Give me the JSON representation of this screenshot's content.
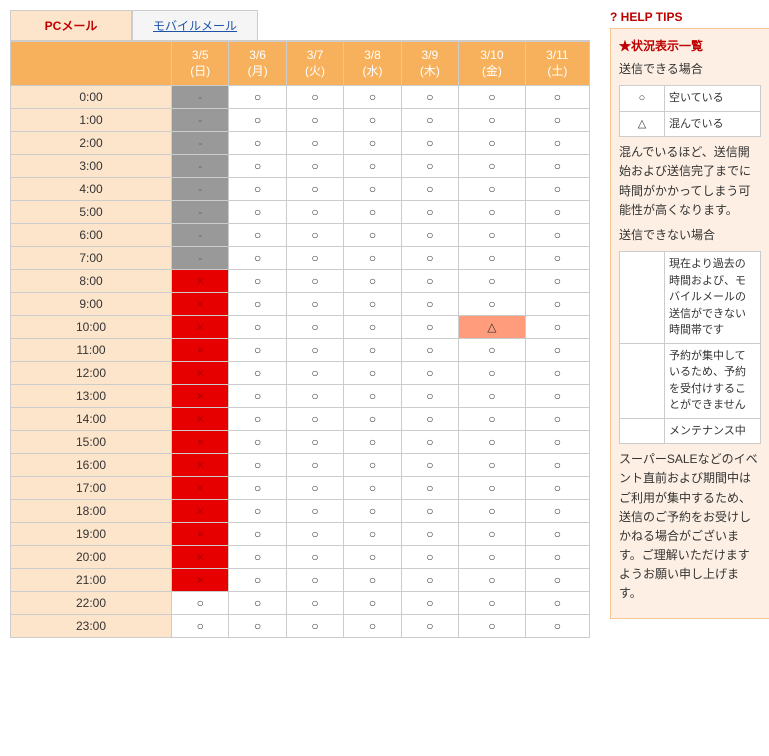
{
  "tabs": {
    "pc": "PCメール",
    "mobile": "モバイルメール"
  },
  "days": [
    {
      "date": "3/5",
      "dow": "(日)"
    },
    {
      "date": "3/6",
      "dow": "(月)"
    },
    {
      "date": "3/7",
      "dow": "(火)"
    },
    {
      "date": "3/8",
      "dow": "(水)"
    },
    {
      "date": "3/9",
      "dow": "(木)"
    },
    {
      "date": "3/10",
      "dow": "(金)"
    },
    {
      "date": "3/11",
      "dow": "(土)"
    }
  ],
  "hours": [
    "0:00",
    "1:00",
    "2:00",
    "3:00",
    "4:00",
    "5:00",
    "6:00",
    "7:00",
    "8:00",
    "9:00",
    "10:00",
    "11:00",
    "12:00",
    "13:00",
    "14:00",
    "15:00",
    "16:00",
    "17:00",
    "18:00",
    "19:00",
    "20:00",
    "21:00",
    "22:00",
    "23:00"
  ],
  "grid": [
    [
      "past",
      "open",
      "open",
      "open",
      "open",
      "open",
      "open"
    ],
    [
      "past",
      "open",
      "open",
      "open",
      "open",
      "open",
      "open"
    ],
    [
      "past",
      "open",
      "open",
      "open",
      "open",
      "open",
      "open"
    ],
    [
      "past",
      "open",
      "open",
      "open",
      "open",
      "open",
      "open"
    ],
    [
      "past",
      "open",
      "open",
      "open",
      "open",
      "open",
      "open"
    ],
    [
      "past",
      "open",
      "open",
      "open",
      "open",
      "open",
      "open"
    ],
    [
      "past",
      "open",
      "open",
      "open",
      "open",
      "open",
      "open"
    ],
    [
      "past",
      "open",
      "open",
      "open",
      "open",
      "open",
      "open"
    ],
    [
      "full",
      "open",
      "open",
      "open",
      "open",
      "open",
      "open"
    ],
    [
      "full",
      "open",
      "open",
      "open",
      "open",
      "open",
      "open"
    ],
    [
      "full",
      "open",
      "open",
      "open",
      "open",
      "crowd",
      "open"
    ],
    [
      "full",
      "open",
      "open",
      "open",
      "open",
      "open",
      "open"
    ],
    [
      "full",
      "open",
      "open",
      "open",
      "open",
      "open",
      "open"
    ],
    [
      "full",
      "open",
      "open",
      "open",
      "open",
      "open",
      "open"
    ],
    [
      "full",
      "open",
      "open",
      "open",
      "open",
      "open",
      "open"
    ],
    [
      "full",
      "open",
      "open",
      "open",
      "open",
      "open",
      "open"
    ],
    [
      "full",
      "open",
      "open",
      "open",
      "open",
      "open",
      "open"
    ],
    [
      "full",
      "open",
      "open",
      "open",
      "open",
      "open",
      "open"
    ],
    [
      "full",
      "open",
      "open",
      "open",
      "open",
      "open",
      "open"
    ],
    [
      "full",
      "open",
      "open",
      "open",
      "open",
      "open",
      "open"
    ],
    [
      "full",
      "open",
      "open",
      "open",
      "open",
      "open",
      "open"
    ],
    [
      "full",
      "open",
      "open",
      "open",
      "open",
      "open",
      "open"
    ],
    [
      "open",
      "open",
      "open",
      "open",
      "open",
      "open",
      "open"
    ],
    [
      "open",
      "open",
      "open",
      "open",
      "open",
      "open",
      "open"
    ]
  ],
  "symbols": {
    "open": "○",
    "past": "-",
    "full": "×",
    "crowd": "△",
    "maint": "-"
  },
  "help": {
    "title": "HELP TIPS",
    "heading": "★状況表示一覧",
    "sendable": "送信できる場合",
    "unsendable": "送信できない場合",
    "note1": "混んでいるほど、送信開始および送信完了までに時間がかかってしまう可能性が高くなります。",
    "note2": "スーパーSALEなどのイベント直前および期間中はご利用が集中するため、送信のご予約をお受けしかねる場合がございます。ご理解いただけますようお願い申し上げます。",
    "legend": {
      "open": "空いている",
      "crowd": "混んでいる",
      "past": "現在より過去の時間および、モバイルメールの送信ができない時間帯です",
      "full": "予約が集中しているため、予約を受付けすることができません",
      "maint": "メンテナンス中"
    }
  }
}
